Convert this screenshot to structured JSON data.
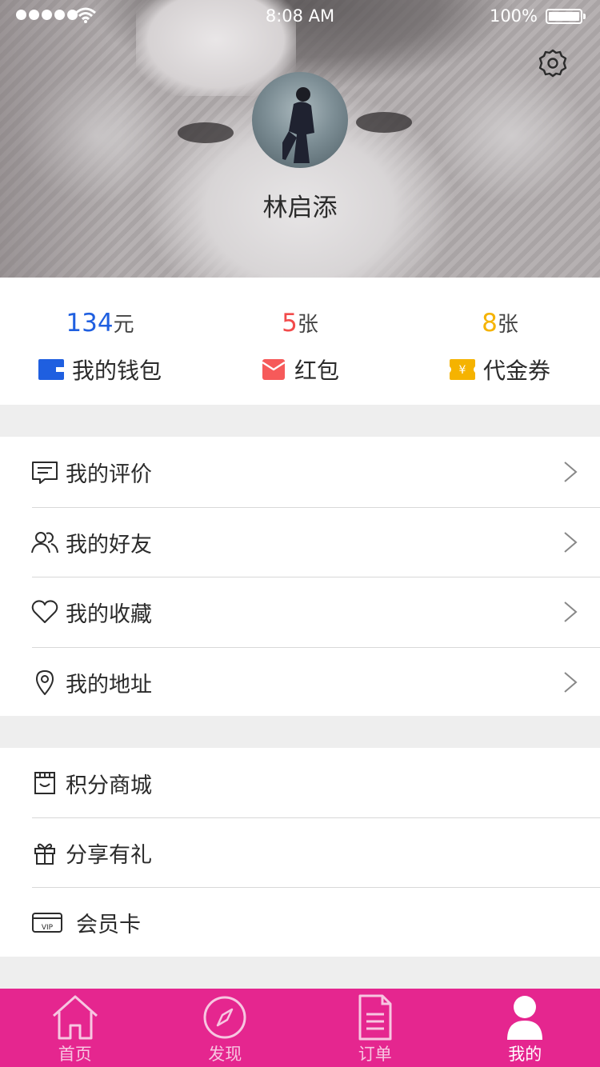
{
  "status_bar": {
    "time": "8:08 AM",
    "battery": "100%"
  },
  "profile": {
    "name": "林启添"
  },
  "stats": [
    {
      "value": "134",
      "unit": "元",
      "label": "我的钱包",
      "icon": "wallet-icon",
      "color": "#1f5fe0"
    },
    {
      "value": "5",
      "unit": "张",
      "label": "红包",
      "icon": "red-envelope-icon",
      "color": "#f24b4b"
    },
    {
      "value": "8",
      "unit": "张",
      "label": "代金券",
      "icon": "coupon-icon",
      "color": "#f5b300"
    }
  ],
  "menu_main": [
    {
      "label": "我的评价",
      "icon": "comment-icon"
    },
    {
      "label": "我的好友",
      "icon": "friends-icon"
    },
    {
      "label": "我的收藏",
      "icon": "heart-icon"
    },
    {
      "label": "我的地址",
      "icon": "location-pin-icon"
    }
  ],
  "menu_extra": [
    {
      "label": "积分商城",
      "icon": "store-icon"
    },
    {
      "label": "分享有礼",
      "icon": "gift-icon"
    },
    {
      "label": "会员卡",
      "icon": "vip-card-icon"
    }
  ],
  "tabs": [
    {
      "label": "首页",
      "icon": "home-icon",
      "active": false
    },
    {
      "label": "发现",
      "icon": "compass-icon",
      "active": false
    },
    {
      "label": "订单",
      "icon": "document-icon",
      "active": false
    },
    {
      "label": "我的",
      "icon": "user-icon",
      "active": true
    }
  ],
  "colors": {
    "tabbar": "#e5268f",
    "background": "#eeeeee"
  }
}
